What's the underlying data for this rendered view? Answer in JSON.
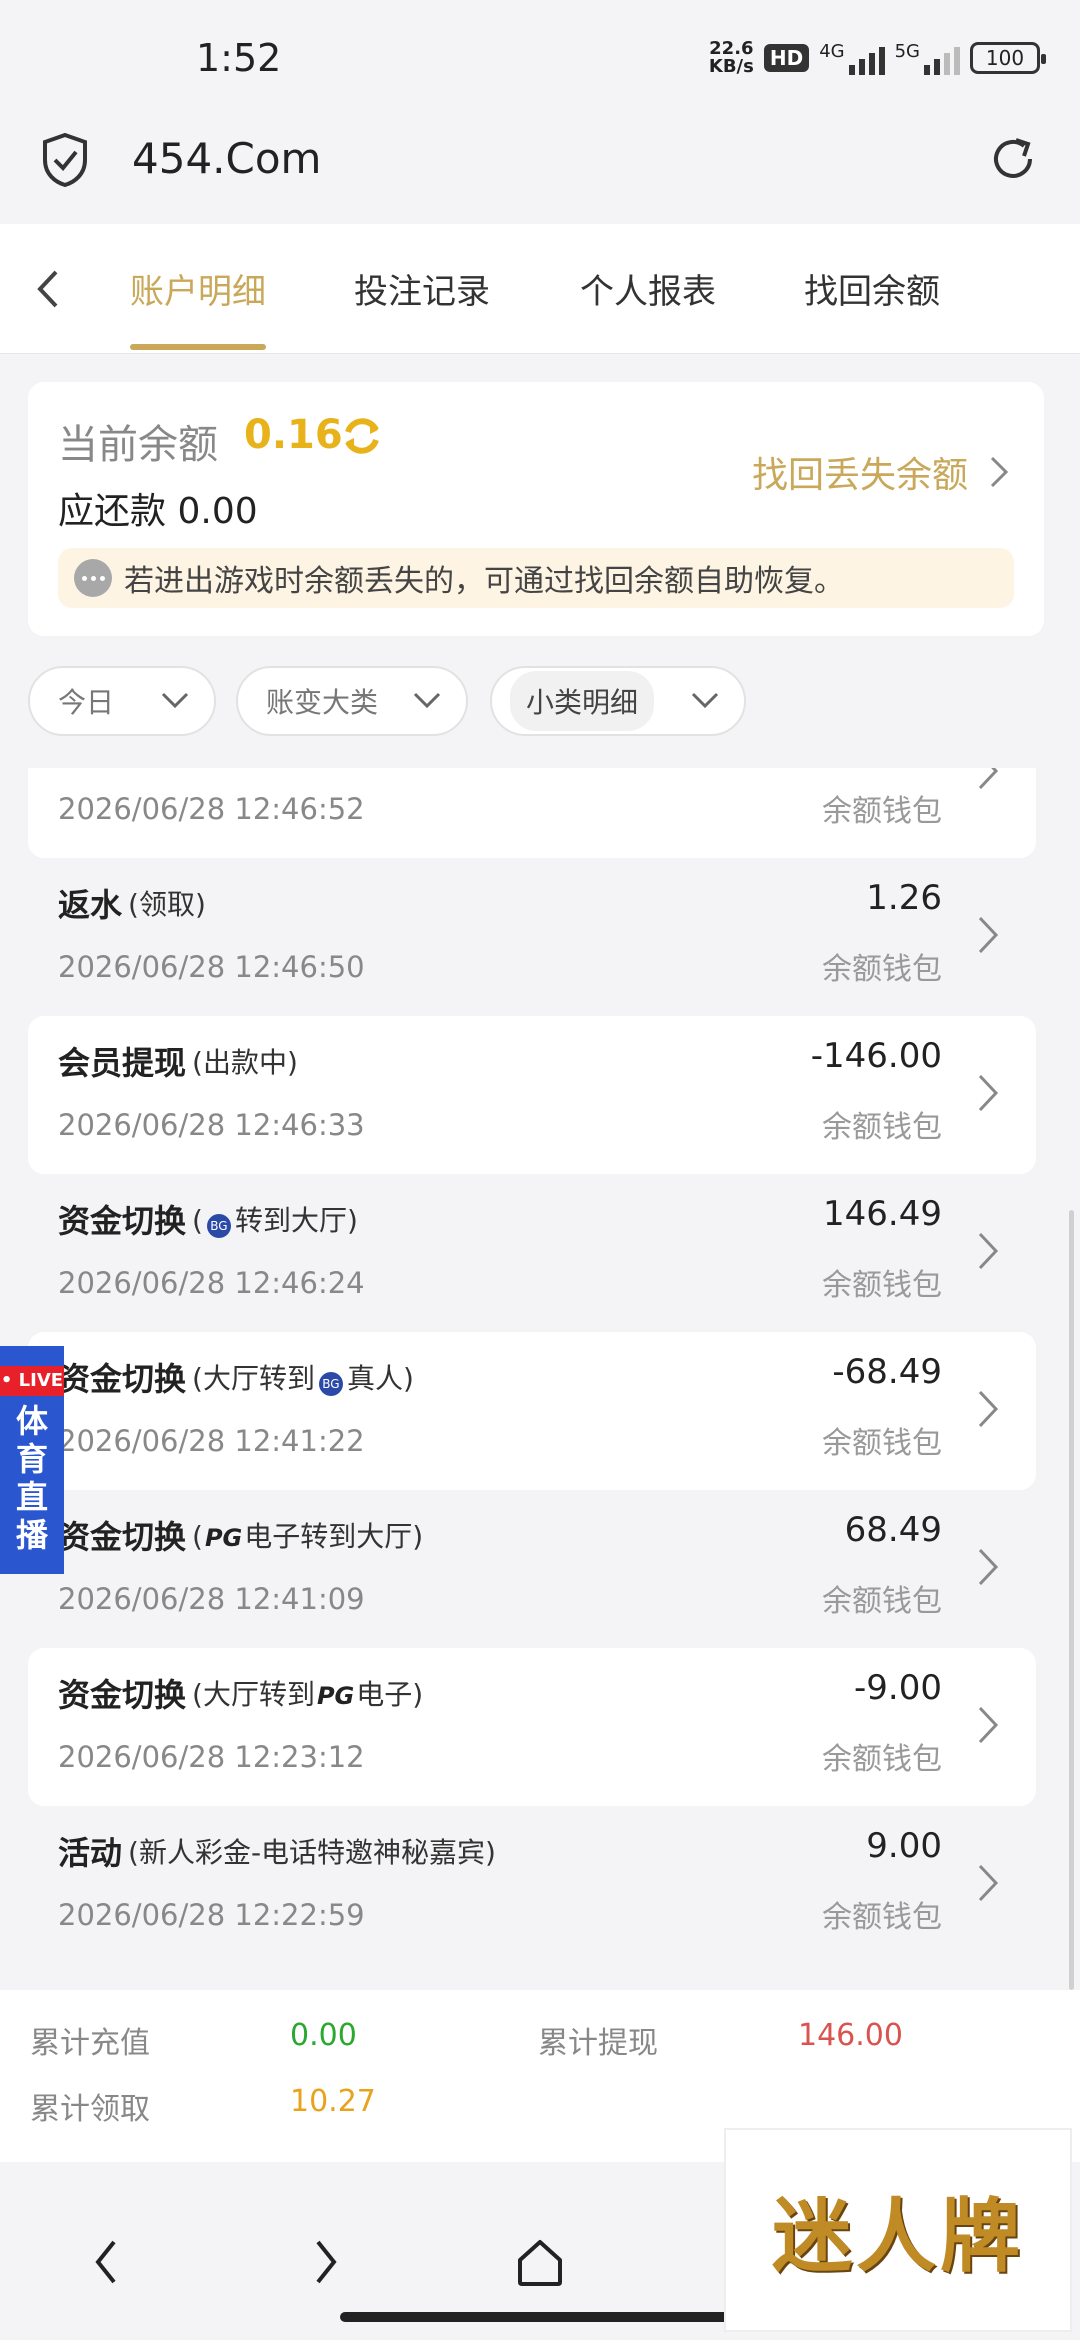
{
  "status_bar": {
    "time": "1:52",
    "net_speed_value": "22.6",
    "net_speed_unit": "KB/s",
    "hd": "HD",
    "sim1": "4G",
    "sim2": "5G",
    "battery": "100"
  },
  "browser": {
    "url": "454.Com"
  },
  "tabs": [
    {
      "label": "账户明细",
      "active": true
    },
    {
      "label": "投注记录",
      "active": false
    },
    {
      "label": "个人报表",
      "active": false
    },
    {
      "label": "找回余额",
      "active": false
    }
  ],
  "balance": {
    "label": "当前余额",
    "value": "0.16",
    "owe_label": "应还款",
    "owe_value": "0.00",
    "recover_link": "找回丢失余额",
    "notice": "若进出游戏时余额丢失的，可通过找回余额自助恢复。"
  },
  "filters": {
    "date": "今日",
    "category": "账变大类",
    "subcategory": "小类明细"
  },
  "transactions": [
    {
      "title": "",
      "sub": "",
      "amount": "",
      "wallet": "余额钱包",
      "date": "2026/06/28 12:46:52"
    },
    {
      "title": "返水",
      "sub": "(领取)",
      "amount": "1.26",
      "wallet": "余额钱包",
      "date": "2026/06/28 12:46:50"
    },
    {
      "title": "会员提现",
      "sub": "(出款中)",
      "amount": "-146.00",
      "wallet": "余额钱包",
      "date": "2026/06/28 12:46:33"
    },
    {
      "title": "资金切换",
      "sub_pre": "(",
      "sub_icon": "BG",
      "sub_post": "转到大厅)",
      "amount": "146.49",
      "wallet": "余额钱包",
      "date": "2026/06/28 12:46:24"
    },
    {
      "title": "资金切换",
      "sub_pre": "(大厅转到",
      "sub_icon": "BG",
      "sub_post": "真人)",
      "amount": "-68.49",
      "wallet": "余额钱包",
      "date": "2026/06/28 12:41:22"
    },
    {
      "title": "资金切换",
      "sub_pre": "(",
      "sub_icon": "PG",
      "sub_post": "电子转到大厅)",
      "amount": "68.49",
      "wallet": "余额钱包",
      "date": "2026/06/28 12:41:09"
    },
    {
      "title": "资金切换",
      "sub_pre": "(大厅转到",
      "sub_icon": "PG",
      "sub_post": "电子)",
      "amount": "-9.00",
      "wallet": "余额钱包",
      "date": "2026/06/28 12:23:12"
    },
    {
      "title": "活动",
      "sub": "(新人彩金-电话特邀神秘嘉宾)",
      "amount": "9.00",
      "wallet": "余额钱包",
      "date": "2026/06/28 12:22:59"
    }
  ],
  "live_badge": {
    "tag": "• LIVE",
    "text": "体育直播"
  },
  "summary": {
    "recharge_label": "累计充值",
    "recharge_value": "0.00",
    "withdraw_label": "累计提现",
    "withdraw_value": "146.00",
    "claim_label": "累计领取",
    "claim_value": "10.27"
  },
  "watermark": "迷人牌",
  "colors": {
    "accent": "#c9a85a",
    "balance": "#e8b21b",
    "green": "#2aa830",
    "red": "#d9534f",
    "orange": "#e8a21b"
  }
}
